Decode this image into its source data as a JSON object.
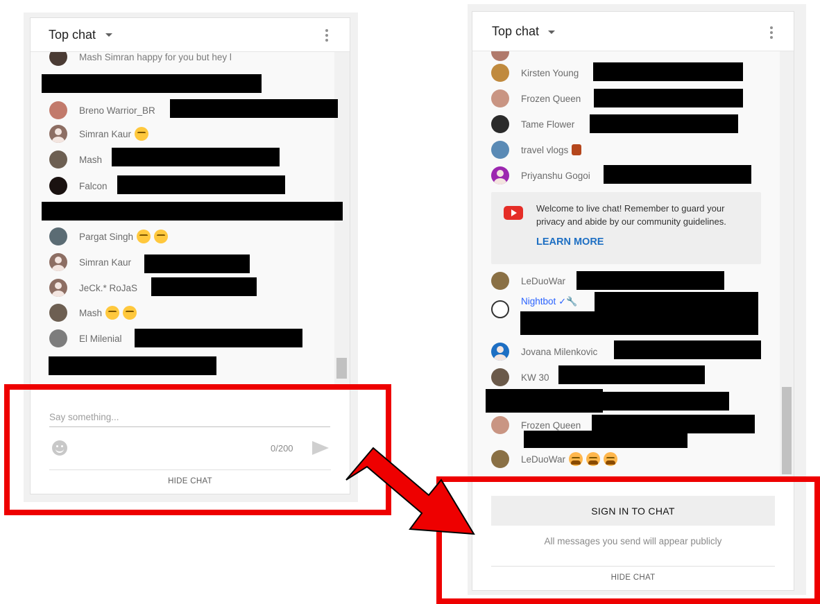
{
  "left_panel": {
    "header": {
      "title": "Top chat"
    },
    "partial_message": "Mash  Simran happy for you but hey l",
    "messages": [
      {
        "author": "Breno Warrior_BR"
      },
      {
        "author": "Simran Kaur"
      },
      {
        "author": "Mash"
      },
      {
        "author": "Falcon"
      },
      {
        "author": "Pargat Singh"
      },
      {
        "author": "Simran Kaur"
      },
      {
        "author": "JeCk.* RoJaS"
      },
      {
        "author": "Mash"
      },
      {
        "author": "El Milenial"
      }
    ],
    "input": {
      "placeholder": "Say something...",
      "counter": "0/200"
    },
    "hide_chat_label": "HIDE CHAT"
  },
  "right_panel": {
    "header": {
      "title": "Top chat"
    },
    "messages_top": [
      {
        "author": "Kirsten Young"
      },
      {
        "author": "Frozen Queen"
      },
      {
        "author": "Tame Flower"
      },
      {
        "author": "travel vlogs"
      },
      {
        "author": "Priyanshu Gogoi"
      }
    ],
    "notice": {
      "text": "Welcome to live chat! Remember to guard your privacy and abide by our community guidelines.",
      "learn_more": "LEARN MORE"
    },
    "messages_bottom": [
      {
        "author": "LeDuoWar"
      },
      {
        "author": "Nightbot",
        "badges": "✓🔧"
      },
      {
        "author": "Jovana Milenkovic"
      },
      {
        "author": "KW 30"
      },
      {
        "author": "Frozen Queen"
      },
      {
        "author": "LeDuoWar"
      }
    ],
    "sign_in_label": "SIGN IN TO CHAT",
    "public_note": "All messages you send will appear publicly",
    "hide_chat_label": "HIDE CHAT"
  },
  "colors": {
    "highlight_box": "#ee0000",
    "arrow": "#ee0000",
    "youtube_red": "#e52d27",
    "learn_more_blue": "#1e6fc3"
  }
}
